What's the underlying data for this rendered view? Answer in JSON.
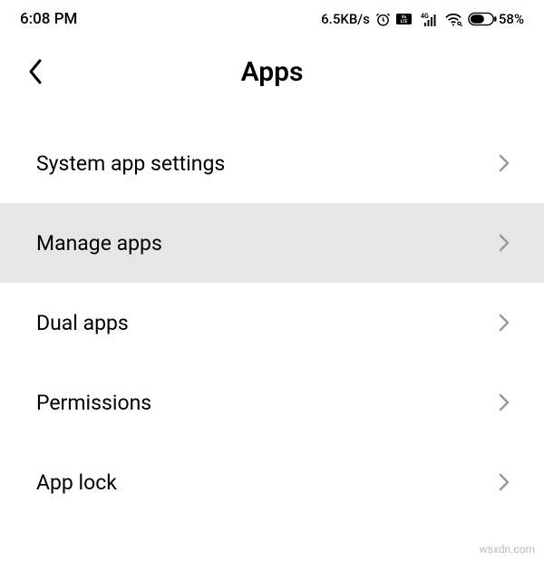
{
  "statusBar": {
    "time": "6:08 PM",
    "network_speed": "6.5KB/s",
    "battery_percent": "58%"
  },
  "header": {
    "title": "Apps"
  },
  "list": {
    "items": [
      {
        "label": "System app settings",
        "highlighted": false
      },
      {
        "label": "Manage apps",
        "highlighted": true
      },
      {
        "label": "Dual apps",
        "highlighted": false
      },
      {
        "label": "Permissions",
        "highlighted": false
      },
      {
        "label": "App lock",
        "highlighted": false
      }
    ]
  },
  "watermark": "wsxdn.com"
}
